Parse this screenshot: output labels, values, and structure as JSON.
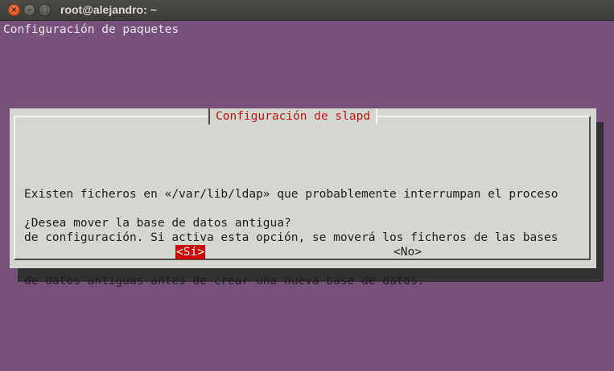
{
  "window": {
    "title": "root@alejandro: ~",
    "close_glyph": "×",
    "minimize_glyph": "–",
    "maximize_glyph": "□"
  },
  "terminal": {
    "backtitle": "Configuración de paquetes"
  },
  "dialog": {
    "title": "Configuración de slapd",
    "message_lines": [
      "Existen ficheros en «/var/lib/ldap» que probablemente interrumpan el proceso",
      "de configuración. Si activa esta opción, se moverá los ficheros de las bases",
      "de datos antiguas antes de crear una nueva base de datos."
    ],
    "question": "¿Desea mover la base de datos antigua?",
    "yes_label": "<Sí>",
    "no_label": "<No>"
  },
  "colors": {
    "terminal_bg": "#76527a",
    "dialog_bg": "#d3d7cf",
    "title_red": "#c01818",
    "selected_button_bg": "#cc0000"
  }
}
